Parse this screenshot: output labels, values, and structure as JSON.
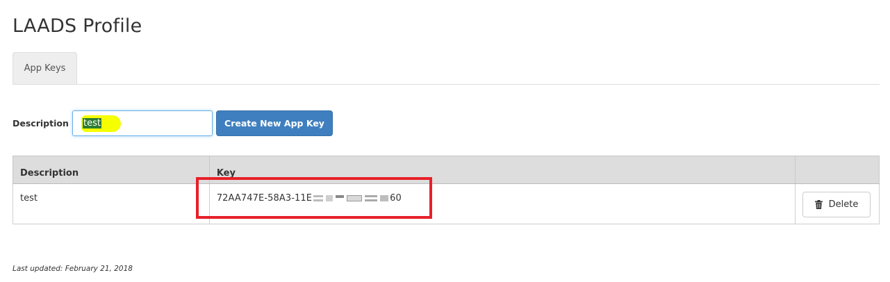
{
  "page": {
    "title": "LAADS Profile"
  },
  "tabs": [
    {
      "label": "App Keys",
      "active": true
    }
  ],
  "form": {
    "description_label": "Description",
    "description_value": "test",
    "create_button_label": "Create New App Key"
  },
  "table": {
    "columns": [
      "Description",
      "Key",
      ""
    ],
    "rows": [
      {
        "description": "test",
        "key_prefix": "72AA747E-58A3-11E",
        "key_suffix": "60",
        "key_redacted": true,
        "action_label": "Delete",
        "action_icon": "trash-icon"
      }
    ]
  },
  "annotations": {
    "highlight_color": "#f5ff00",
    "box_color": "#e8202a"
  },
  "footer": {
    "last_updated": "Last updated: February 21, 2018"
  },
  "colors": {
    "primary_button": "#3f7fbf",
    "table_header": "#dddddd",
    "input_focus": "#66afe9"
  }
}
